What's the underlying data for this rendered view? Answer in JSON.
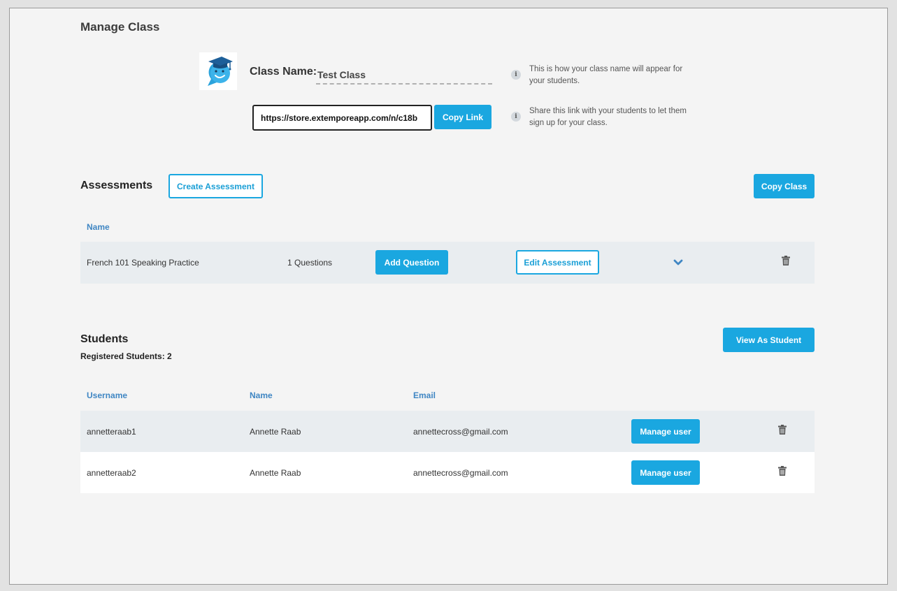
{
  "page": {
    "title": "Manage Class"
  },
  "class_info": {
    "name_label": "Class Name:",
    "name_value": "Test Class",
    "name_hint": "This is how your class name will appear for your students.",
    "link_value": "https://store.extemporeapp.com/n/c18b",
    "copy_link_label": "Copy Link",
    "link_hint": "Share this link with your students to let them sign up for your class.",
    "info_glyph": "i"
  },
  "assessments": {
    "title": "Assessments",
    "create_label": "Create Assessment",
    "copy_class_label": "Copy Class",
    "column_name": "Name",
    "rows": [
      {
        "name": "French 101 Speaking Practice",
        "questions": "1 Questions",
        "add_question_label": "Add Question",
        "edit_label": "Edit Assessment"
      }
    ]
  },
  "students": {
    "title": "Students",
    "registered": "Registered Students: 2",
    "view_as_student_label": "View As Student",
    "columns": {
      "username": "Username",
      "name": "Name",
      "email": "Email"
    },
    "rows": [
      {
        "username": "annetteraab1",
        "name": "Annette Raab",
        "email": "annettecross@gmail.com",
        "manage_label": "Manage user"
      },
      {
        "username": "annetteraab2",
        "name": "Annette Raab",
        "email": "annettecross@gmail.com",
        "manage_label": "Manage user"
      }
    ]
  },
  "icons": [
    "mascot-logo",
    "info-icon",
    "chevron-down-icon",
    "trash-icon"
  ],
  "colors": {
    "accent": "#1aa7e0",
    "header_text": "#3f86c3",
    "row_alt": "#e9edf0",
    "background": "#f4f4f4"
  }
}
